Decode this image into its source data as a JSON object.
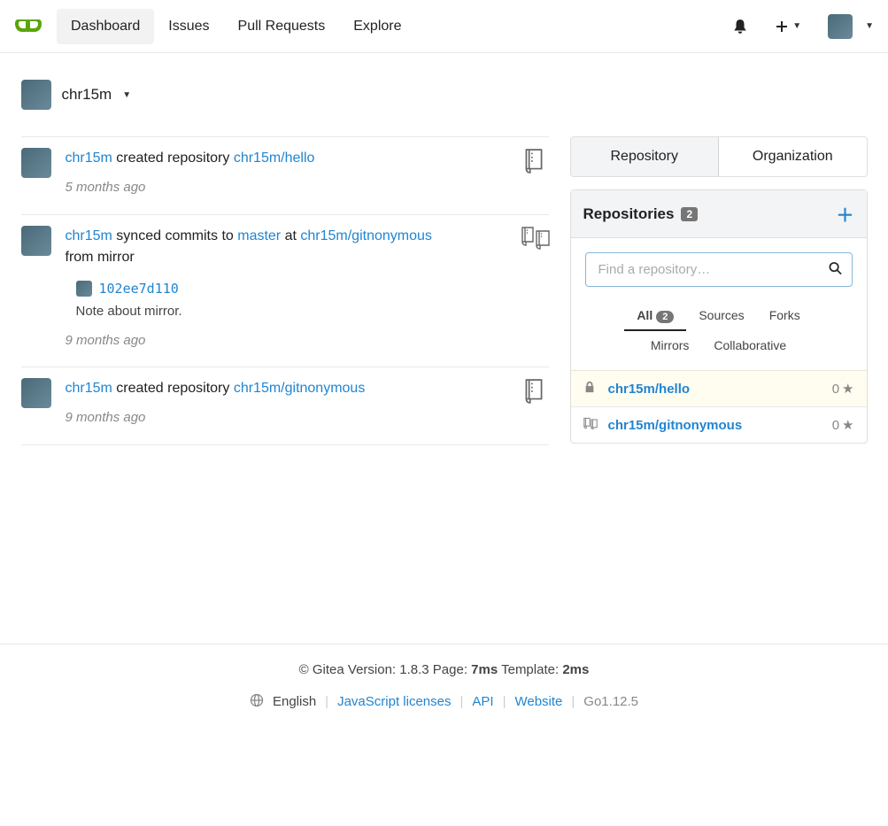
{
  "nav": {
    "dashboard": "Dashboard",
    "issues": "Issues",
    "pull_requests": "Pull Requests",
    "explore": "Explore"
  },
  "context": {
    "username": "chr15m"
  },
  "feed": {
    "item0": {
      "user": "chr15m",
      "action": " created repository ",
      "repo": "chr15m/hello",
      "time": "5 months ago"
    },
    "item1": {
      "user": "chr15m",
      "action1": " synced commits to ",
      "branch": "master",
      "at": " at ",
      "repo": "chr15m/gitnonymous",
      "suffix": "from mirror",
      "commit_sha": "102ee7d110",
      "commit_msg": "Note about mirror.",
      "time": "9 months ago"
    },
    "item2": {
      "user": "chr15m",
      "action": " created repository ",
      "repo": "chr15m/gitnonymous",
      "time": "9 months ago"
    }
  },
  "sidebar": {
    "tab_repo": "Repository",
    "tab_org": "Organization",
    "repos_label": "Repositories",
    "repos_count": "2",
    "search_placeholder": "Find a repository…",
    "filters": {
      "all": "All",
      "all_count": "2",
      "sources": "Sources",
      "forks": "Forks",
      "mirrors": "Mirrors",
      "collab": "Collaborative"
    },
    "repos": {
      "r0": {
        "name": "chr15m/hello",
        "stars": "0"
      },
      "r1": {
        "name": "chr15m/gitnonymous",
        "stars": "0"
      }
    }
  },
  "footer": {
    "prefix": "© Gitea Version: 1.8.3 Page: ",
    "page_time": "7ms",
    "mid": " Template: ",
    "tmpl_time": "2ms",
    "lang": "English",
    "js": "JavaScript licenses",
    "api": "API",
    "website": "Website",
    "go": "Go1.12.5"
  }
}
